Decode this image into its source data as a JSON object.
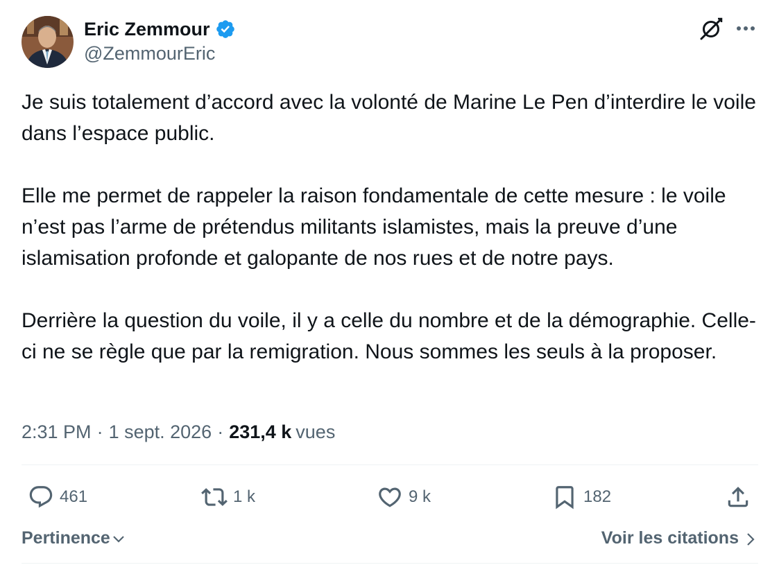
{
  "author": {
    "name": "Eric Zemmour",
    "handle": "@ZemmourEric",
    "verified": true
  },
  "tweet": {
    "paragraphs": [
      "Je suis totalement d’accord avec la volonté de Marine Le Pen d’interdire le voile dans l’espace public.",
      "Elle me permet de rappeler la raison fondamentale de cette mesure : le voile n’est pas l’arme de prétendus militants islamistes, mais la preuve d’une islamisation profonde et galopante de nos rues et de notre pays.",
      "Derrière la question du voile, il y a celle du nombre et de la démographie. Celle-ci ne se règle que par la remigration. Nous sommes les seuls à la proposer."
    ]
  },
  "meta": {
    "time": "2:31 PM",
    "separator": "·",
    "date": "1 sept. 2026",
    "views_count": "231,4 k",
    "views_label": "vues"
  },
  "actions": {
    "replies": "461",
    "reposts": "1 k",
    "likes": "9 k",
    "bookmarks": "182"
  },
  "footer": {
    "sort_label": "Pertinence",
    "quotes_label": "Voir les citations"
  },
  "colors": {
    "text_primary": "#0f1419",
    "text_secondary": "#536471",
    "verified_blue": "#1d9bf0",
    "divider": "#eff3f4"
  },
  "icons": {
    "verified": "verified-badge-icon",
    "grok": "grok-icon",
    "more": "more-icon",
    "reply": "reply-icon",
    "repost": "repost-icon",
    "like": "heart-icon",
    "bookmark": "bookmark-icon",
    "share": "share-icon",
    "sort": "chevron-down-icon",
    "quotes": "chevron-right-icon"
  }
}
